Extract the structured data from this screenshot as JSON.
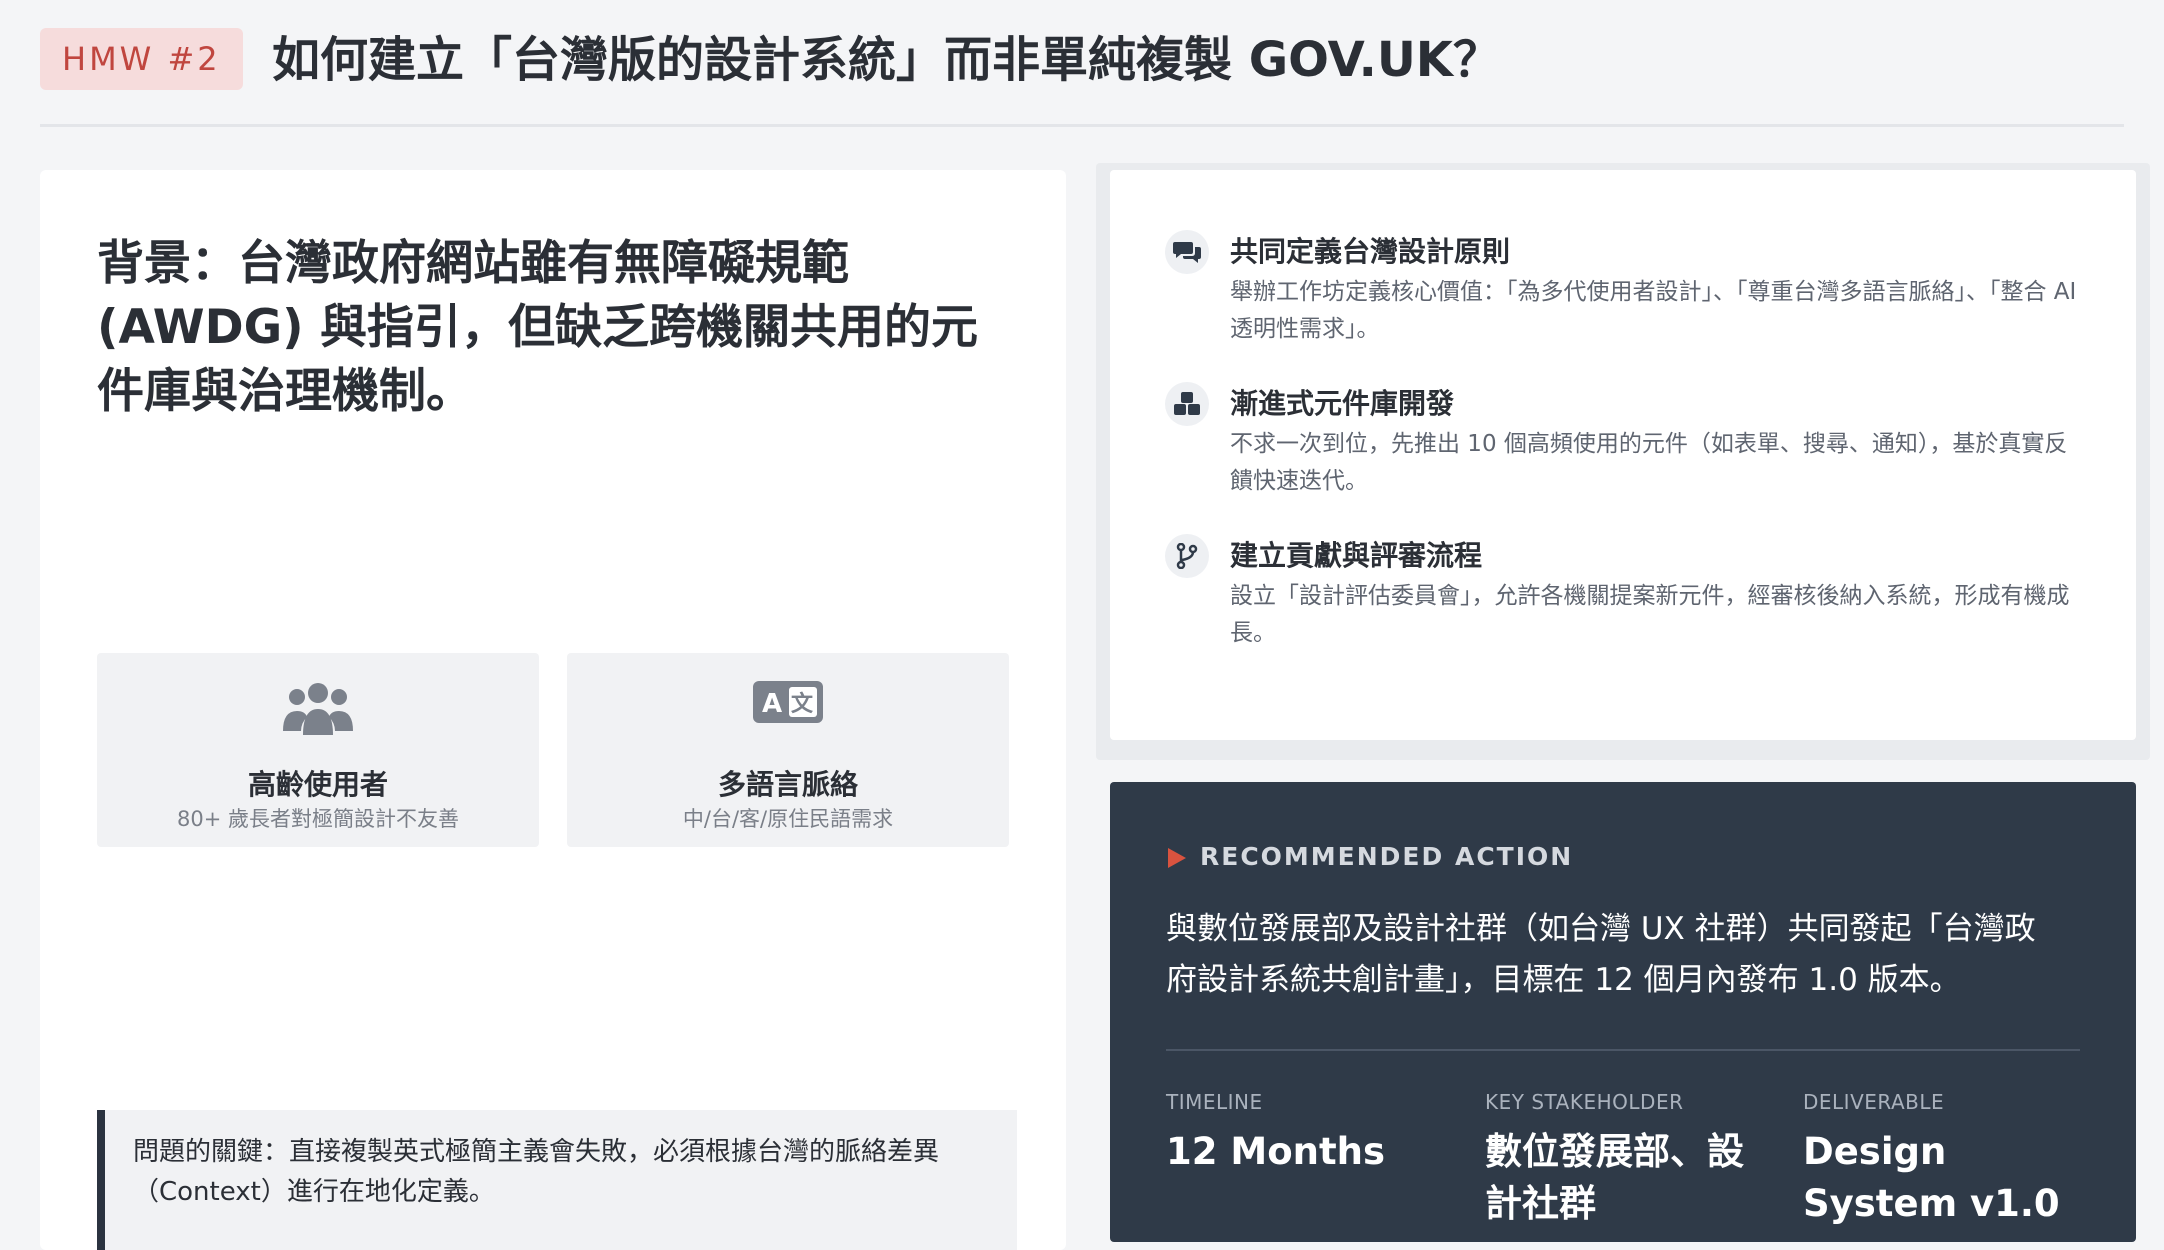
{
  "header": {
    "badge": "HMW #2",
    "title": "如何建立「台灣版的設計系統」而非單純複製 GOV.UK？"
  },
  "background": {
    "heading": "背景：台灣政府網站雖有無障礙規範 (AWDG) 與指引，但缺乏跨機關共用的元件庫與治理機制。",
    "stats": [
      {
        "icon": "users-icon",
        "title": "高齡使用者",
        "subtitle": "80+ 歲長者對極簡設計不友善"
      },
      {
        "icon": "translate-icon",
        "title": "多語言脈絡",
        "subtitle": "中/台/客/原住民語需求"
      }
    ],
    "callout": "問題的關鍵：直接複製英式極簡主義會失敗，必須根據台灣的脈絡差異（Context）進行在地化定義。"
  },
  "principles": [
    {
      "icon": "chat-icon",
      "title": "共同定義台灣設計原則",
      "description": "舉辦工作坊定義核心價值：「為多代使用者設計」、「尊重台灣多語言脈絡」、「整合 AI 透明性需求」。"
    },
    {
      "icon": "cubes-icon",
      "title": "漸進式元件庫開發",
      "description": "不求一次到位，先推出 10 個高頻使用的元件（如表單、搜尋、通知），基於真實反饋快速迭代。"
    },
    {
      "icon": "branch-icon",
      "title": "建立貢獻與評審流程",
      "description": "設立「設計評估委員會」，允許各機關提案新元件，經審核後納入系統，形成有機成長。"
    }
  ],
  "action": {
    "label": "RECOMMENDED ACTION",
    "text": "與數位發展部及設計社群（如台灣 UX 社群）共同發起「台灣政府設計系統共創計畫」，目標在 12 個月內發布 1.0 版本。",
    "kpis": [
      {
        "label": "TIMELINE",
        "value": "12 Months"
      },
      {
        "label": "KEY STAKEHOLDER",
        "value": "數位發展部、設計社群"
      },
      {
        "label": "DELIVERABLE",
        "value": "Design System v1.0"
      }
    ]
  },
  "colors": {
    "accent": "#c0463f",
    "badge_bg": "#f6dcdc",
    "dark_panel": "#2f3a48",
    "page_bg": "#f4f5f7"
  }
}
